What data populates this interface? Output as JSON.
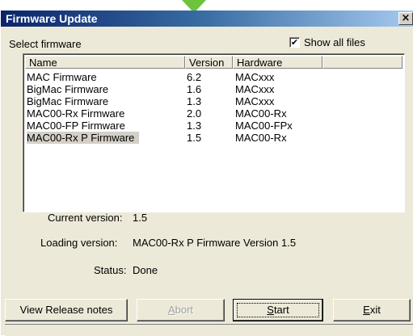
{
  "window": {
    "title": "Firmware Update",
    "close_glyph": "×"
  },
  "select_label": "Select firmware",
  "show_all": {
    "checked": true,
    "glyph": "✔",
    "label": "Show all files"
  },
  "table": {
    "columns": [
      "Name",
      "Version",
      "Hardware"
    ],
    "rows": [
      {
        "name": "MAC Firmware",
        "version": "6.2",
        "hardware": "MACxxx"
      },
      {
        "name": "BigMac Firmware",
        "version": "1.6",
        "hardware": "MACxxx"
      },
      {
        "name": "BigMac Firmware",
        "version": "1.3",
        "hardware": "MACxxx"
      },
      {
        "name": "MAC00-Rx Firmware",
        "version": "2.0",
        "hardware": "MAC00-Rx"
      },
      {
        "name": "MAC00-FP Firmware",
        "version": "1.3",
        "hardware": "MAC00-FPx"
      },
      {
        "name": "MAC00-Rx P Firmware",
        "version": "1.5",
        "hardware": "MAC00-Rx",
        "selected": true
      }
    ]
  },
  "info": {
    "current_label": "Current version:",
    "current_value": "1.5",
    "loading_label": "Loading version:",
    "loading_value": "MAC00-Rx P Firmware Version 1.5",
    "status_label": "Status:",
    "status_value": "Done"
  },
  "buttons": {
    "release_notes": "View Release notes",
    "abort_first": "A",
    "abort_rest": "bort",
    "start_first": "S",
    "start_rest": "tart",
    "exit_first": "E",
    "exit_rest": "xit"
  }
}
